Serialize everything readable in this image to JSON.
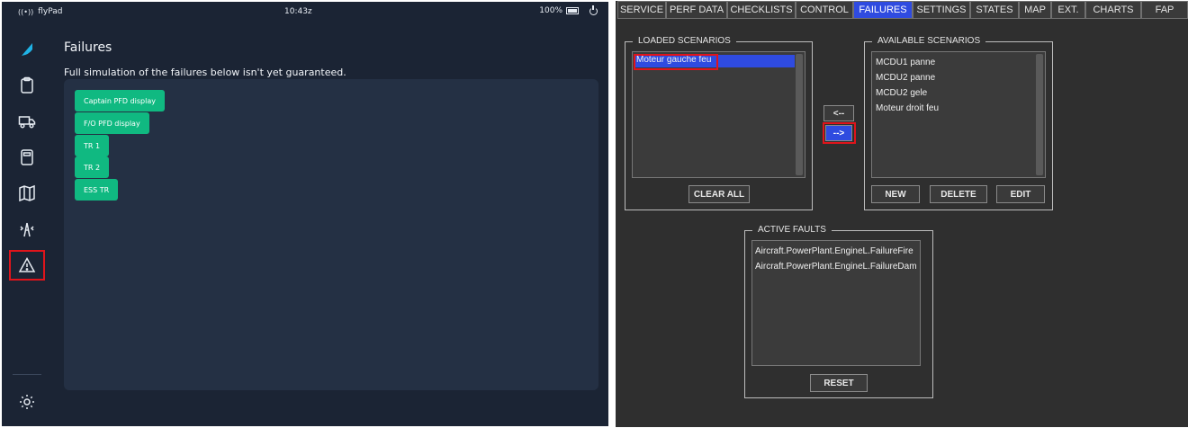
{
  "flypad": {
    "app_name": "flyPad",
    "time": "10:43z",
    "battery": "100%",
    "title": "Failures",
    "note": "Full simulation of the failures below isn't yet guaranteed.",
    "failures": [
      "Captain PFD display",
      "F/O PFD display",
      "TR 1",
      "TR 2",
      "ESS TR"
    ],
    "nav_icons": [
      "logo-icon",
      "clipboard-icon",
      "truck-icon",
      "calculator-icon",
      "map-icon",
      "atc-tower-icon",
      "warning-icon",
      "settings-icon"
    ],
    "accent": "#10b981",
    "highlight": "#e0141b"
  },
  "a3": {
    "tabs": [
      "SERVICE",
      "PERF DATA",
      "CHECKLISTS",
      "CONTROL",
      "FAILURES",
      "SETTINGS",
      "STATES",
      "MAP",
      "EXT.",
      "CHARTS",
      "FAP"
    ],
    "active_tab": "FAILURES",
    "loaded": {
      "title": "LOADED SCENARIOS",
      "items": [
        "Moteur gauche feu"
      ],
      "clear_label": "CLEAR ALL"
    },
    "transfer": {
      "left_label": "<--",
      "right_label": "-->"
    },
    "available": {
      "title": "AVAILABLE SCENARIOS",
      "items": [
        "MCDU1 panne",
        "MCDU2 panne",
        "MCDU2 gele",
        "Moteur droit feu"
      ],
      "new_label": "NEW",
      "delete_label": "DELETE",
      "edit_label": "EDIT"
    },
    "faults": {
      "title": "ACTIVE FAULTS",
      "items": [
        "Aircraft.PowerPlant.EngineL.FailureFire",
        "Aircraft.PowerPlant.EngineL.FailureDam"
      ],
      "reset_label": "RESET"
    },
    "selected_color": "#2f4be0"
  }
}
